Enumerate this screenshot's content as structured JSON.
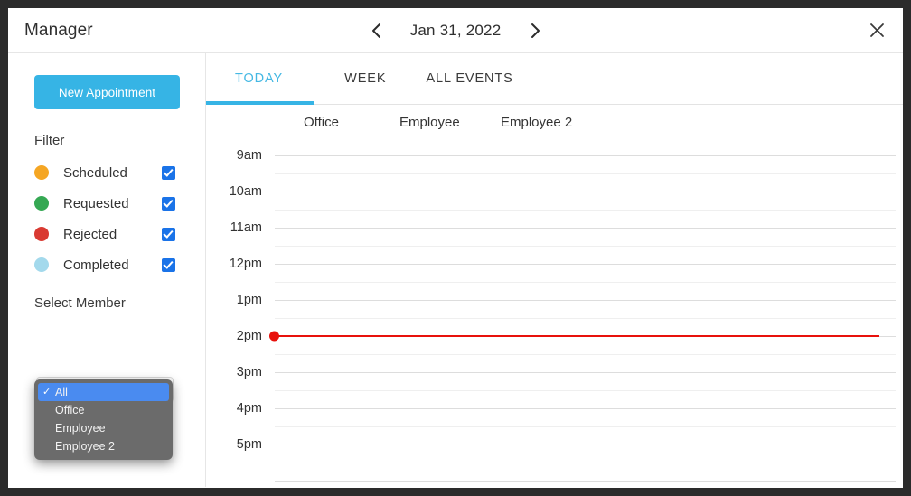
{
  "window": {
    "title": "Manager",
    "close_icon": "close-icon"
  },
  "header": {
    "prev_icon": "chevron-left-icon",
    "next_icon": "chevron-right-icon",
    "date_label": "Jan 31, 2022"
  },
  "sidebar": {
    "new_appointment_label": "New Appointment",
    "filter_title": "Filter",
    "filters": [
      {
        "label": "Scheduled",
        "color": "#f5a623",
        "checked": true
      },
      {
        "label": "Requested",
        "color": "#35a853",
        "checked": true
      },
      {
        "label": "Rejected",
        "color": "#d93a32",
        "checked": true
      },
      {
        "label": "Completed",
        "color": "#a3d9ec",
        "checked": true
      }
    ],
    "select_member_title": "Select Member",
    "member_select_value": "All",
    "member_dropdown": {
      "open": true,
      "check_glyph": "✓",
      "options": [
        {
          "label": "All",
          "selected": true
        },
        {
          "label": "Office",
          "selected": false
        },
        {
          "label": "Employee",
          "selected": false
        },
        {
          "label": "Employee 2",
          "selected": false
        }
      ]
    }
  },
  "main": {
    "tabs": [
      {
        "label": "TODAY",
        "active": true
      },
      {
        "label": "WEEK",
        "active": false
      },
      {
        "label": "ALL EVENTS",
        "active": false
      }
    ],
    "columns": [
      "Office",
      "Employee",
      "Employee 2"
    ],
    "hours": [
      "9am",
      "10am",
      "11am",
      "12pm",
      "1pm",
      "2pm",
      "3pm",
      "4pm",
      "5pm"
    ],
    "current_time_hour": "2pm",
    "current_time_color": "#e8110c",
    "accent_color": "#36b4e5"
  }
}
